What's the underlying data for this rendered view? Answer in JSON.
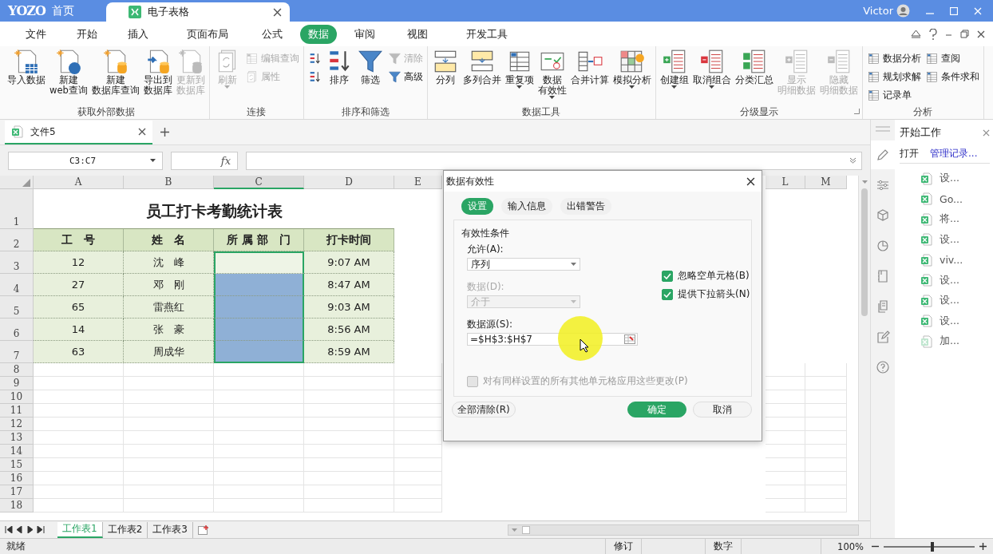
{
  "title_bar": {
    "logo": "YOZO",
    "home": "首页",
    "doc_tab": {
      "label": "电子表格",
      "selected": true
    },
    "user": "Victor"
  },
  "menu_tabs": [
    {
      "label": "文件",
      "selected": false
    },
    {
      "label": "开始",
      "selected": false
    },
    {
      "label": "插入",
      "selected": false
    },
    {
      "label": "页面布局",
      "selected": false
    },
    {
      "label": "公式",
      "selected": false
    },
    {
      "label": "数据",
      "selected": true
    },
    {
      "label": "审阅",
      "selected": false
    },
    {
      "label": "视图",
      "selected": false
    },
    {
      "label": "开发工具",
      "selected": false
    }
  ],
  "ribbon": {
    "groups": [
      {
        "label": "获取外部数据",
        "items": [
          {
            "kind": "large",
            "lines": [
              "导入数据"
            ],
            "disabled": false
          },
          {
            "kind": "large",
            "lines": [
              "新建",
              "web查询"
            ],
            "disabled": false
          },
          {
            "kind": "large",
            "lines": [
              "新建",
              "数据库查询"
            ],
            "disabled": false
          },
          {
            "kind": "large",
            "lines": [
              "导出到",
              "数据库"
            ],
            "disabled": false
          },
          {
            "kind": "large",
            "lines": [
              "更新到",
              "数据库"
            ],
            "disabled": true
          }
        ]
      },
      {
        "label": "连接",
        "items": [
          {
            "kind": "large",
            "lines": [
              "刷新"
            ],
            "disabled": true,
            "dropdown": true
          },
          {
            "kind": "stack",
            "items": [
              {
                "label": "编辑查询",
                "disabled": true
              },
              {
                "label": "属性",
                "disabled": true
              }
            ]
          }
        ]
      },
      {
        "label": "排序和筛选",
        "items": [
          {
            "kind": "stack",
            "items": [
              {
                "disabled": false
              },
              {
                "disabled": false
              }
            ]
          },
          {
            "kind": "large",
            "lines": [
              "排序"
            ],
            "disabled": false
          },
          {
            "kind": "large",
            "lines": [
              "筛选"
            ],
            "disabled": false
          },
          {
            "kind": "stack",
            "items": [
              {
                "label": "清除",
                "disabled": true
              },
              {
                "label": "高级",
                "disabled": false
              }
            ]
          }
        ]
      },
      {
        "label": "数据工具",
        "items": [
          {
            "kind": "large",
            "lines": [
              "分列"
            ],
            "disabled": false
          },
          {
            "kind": "large",
            "lines": [
              "多列合并"
            ],
            "disabled": false
          },
          {
            "kind": "large",
            "lines": [
              "重复项"
            ],
            "disabled": false,
            "dropdown": true
          },
          {
            "kind": "large",
            "lines": [
              "数据",
              "有效性"
            ],
            "disabled": false,
            "dropdown": true
          },
          {
            "kind": "large",
            "lines": [
              "合并计算"
            ],
            "disabled": false
          },
          {
            "kind": "large",
            "lines": [
              "模拟分析"
            ],
            "disabled": false,
            "dropdown": true
          }
        ]
      },
      {
        "label": "分级显示",
        "launcher": true,
        "items": [
          {
            "kind": "large",
            "lines": [
              "创建组"
            ],
            "disabled": false,
            "dropdown": true
          },
          {
            "kind": "large",
            "lines": [
              "取消组合"
            ],
            "disabled": false,
            "dropdown": true
          },
          {
            "kind": "large",
            "lines": [
              "分类汇总"
            ],
            "disabled": false
          },
          {
            "kind": "large",
            "lines": [
              "显示",
              "明细数据"
            ],
            "disabled": true
          },
          {
            "kind": "large",
            "lines": [
              "隐藏",
              "明细数据"
            ],
            "disabled": true
          }
        ]
      },
      {
        "label": "分析",
        "items": [
          {
            "kind": "stack",
            "items": [
              {
                "label": "数据分析",
                "disabled": false
              },
              {
                "label": "规划求解",
                "disabled": false
              },
              {
                "label": "记录单",
                "disabled": false
              }
            ]
          },
          {
            "kind": "stack",
            "items": [
              {
                "label": "查阅",
                "disabled": false
              },
              {
                "label": "条件求和",
                "disabled": false
              }
            ]
          }
        ]
      }
    ]
  },
  "document_tabs": [
    {
      "label": "文件5",
      "selected": true
    }
  ],
  "formula_bar": {
    "name_box": "C3:C7",
    "fx": "fx"
  },
  "sheet": {
    "columns": [
      {
        "label": "A",
        "selected": false
      },
      {
        "label": "B",
        "selected": false
      },
      {
        "label": "C",
        "selected": true
      },
      {
        "label": "D",
        "selected": false
      },
      {
        "label": "E",
        "selected": false
      },
      {
        "label": "L",
        "selected": false
      },
      {
        "label": "M",
        "selected": false
      }
    ],
    "title_row": "1",
    "title": "员工打卡考勤统计表",
    "header_row": "2",
    "headers": [
      "工　号",
      "姓　名",
      "所 属 部　门",
      "打卡时间"
    ],
    "rows": [
      {
        "number": "3",
        "id": "12",
        "name": "沈　峰",
        "dept_highlighted": false,
        "time": "9:07 AM"
      },
      {
        "number": "4",
        "id": "27",
        "name": "邓　刚",
        "dept_highlighted": true,
        "time": "8:47 AM"
      },
      {
        "number": "5",
        "id": "65",
        "name": "雷燕红",
        "dept_highlighted": true,
        "time": "9:03 AM"
      },
      {
        "number": "6",
        "id": "14",
        "name": "张　豪",
        "dept_highlighted": true,
        "time": "8:56 AM"
      },
      {
        "number": "7",
        "id": "63",
        "name": "周成华",
        "dept_highlighted": true,
        "time": "8:59 AM"
      }
    ],
    "empty_rows": [
      "8",
      "9",
      "10",
      "11",
      "12",
      "13",
      "14",
      "15",
      "16",
      "17",
      "18"
    ]
  },
  "sheet_tabs": [
    {
      "label": "工作表1",
      "selected": true
    },
    {
      "label": "工作表2",
      "selected": false
    },
    {
      "label": "工作表3",
      "selected": false
    }
  ],
  "right_panel": {
    "title": "开始工作",
    "rail": [
      {
        "selected": true
      },
      {
        "selected": false
      },
      {
        "selected": false
      },
      {
        "selected": false
      },
      {
        "selected": false
      },
      {
        "selected": false
      },
      {
        "selected": false
      },
      {
        "selected": false
      }
    ],
    "open_label": "打开",
    "manage_link": "管理记录...",
    "files": [
      "设...",
      "Go...",
      "将...",
      "设...",
      "viv...",
      "设...",
      "设...",
      "设...",
      "加..."
    ]
  },
  "dialog": {
    "title": "数据有效性",
    "tabs": [
      {
        "label": "设置",
        "selected": true
      },
      {
        "label": "输入信息",
        "selected": false
      },
      {
        "label": "出错警告",
        "selected": false
      }
    ],
    "section": "有效性条件",
    "allow": {
      "label": "允许(A):",
      "value": "序列",
      "disabled": false
    },
    "data": {
      "label": "数据(D):",
      "value": "介于",
      "disabled": true
    },
    "source": {
      "label": "数据源(S):",
      "value": "=$H$3:$H$7"
    },
    "options": [
      {
        "label": "忽略空单元格(B)",
        "checked": true
      },
      {
        "label": "提供下拉箭头(N)",
        "checked": true
      }
    ],
    "apply_all": {
      "label": "对有同样设置的所有其他单元格应用这些更改(P)",
      "checked": false,
      "disabled": true
    },
    "clear_button": "全部清除(R)",
    "buttons": [
      {
        "label": "确定",
        "kind": "primary"
      },
      {
        "label": "取消",
        "kind": "secondary"
      }
    ]
  },
  "status_bar": {
    "status": "就绪",
    "indicators": [
      "修订",
      "数字"
    ],
    "zoom": "100%",
    "zoom_slider": {
      "level": 0.52
    }
  }
}
